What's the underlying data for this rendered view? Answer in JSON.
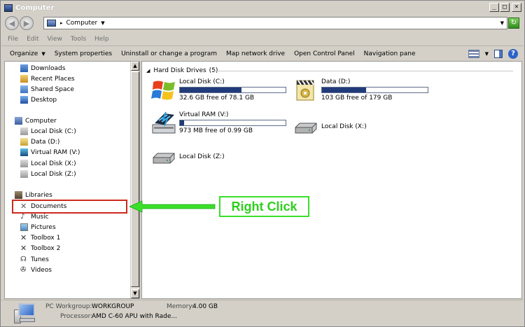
{
  "window": {
    "title": "Computer"
  },
  "address": {
    "path": "Computer"
  },
  "menu": [
    "File",
    "Edit",
    "View",
    "Tools",
    "Help"
  ],
  "toolbar": {
    "organize": "Organize",
    "system_properties": "System properties",
    "uninstall": "Uninstall or change a program",
    "map_drive": "Map network drive",
    "control_panel": "Open Control Panel",
    "nav_pane": "Navigation pane"
  },
  "navpane": {
    "favorites": [
      "Downloads",
      "Recent Places",
      "Shared Space",
      "Desktop"
    ],
    "computer": "Computer",
    "drives": [
      "Local Disk (C:)",
      "Data (D:)",
      "Virtual RAM (V:)",
      "Local Disk (X:)",
      "Local Disk (Z:)"
    ],
    "libraries": "Libraries",
    "library_items": [
      "Documents",
      "Music",
      "Pictures",
      "Toolbox 1",
      "Toolbox 2",
      "Tunes",
      "Videos"
    ]
  },
  "content": {
    "group_title": "Hard Disk Drives",
    "group_count": "(5)",
    "drives": [
      {
        "name": "Local Disk (C:)",
        "free": "32.6 GB free of 78.1 GB",
        "used_fraction": 0.58
      },
      {
        "name": "Data (D:)",
        "free": "103 GB free of 179 GB",
        "used_fraction": 0.42
      },
      {
        "name": "Virtual RAM (V:)",
        "free": "973 MB free of 0.99 GB",
        "used_fraction": 0.04
      },
      {
        "name": "Local Disk (X:)"
      },
      {
        "name": "Local Disk (Z:)"
      }
    ]
  },
  "status": {
    "workgroup_label": "PC  Workgroup:",
    "workgroup_value": "WORKGROUP",
    "memory_label": "Memory:",
    "memory_value": "4.00 GB",
    "processor_label": "Processor:",
    "processor_value": "AMD C-60 APU with Rade..."
  },
  "annotation": {
    "callout": "Right Click"
  },
  "colors": {
    "drive_bar": "#213b7a",
    "highlight": "#cc2a1c",
    "callout_green": "#3adf2a"
  }
}
